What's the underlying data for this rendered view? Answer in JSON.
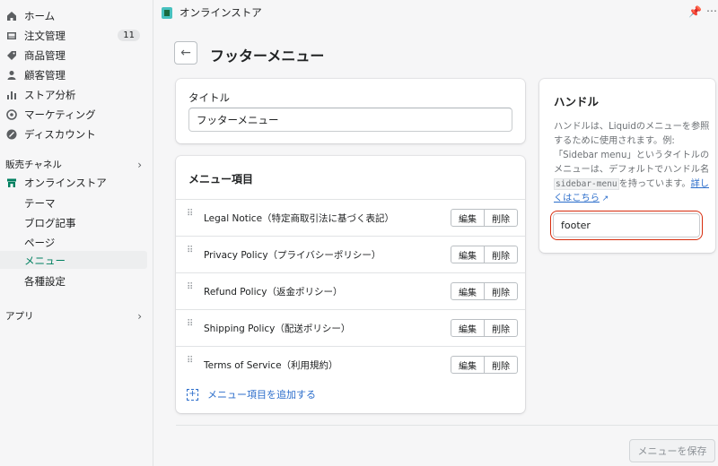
{
  "sidebar": {
    "items": [
      {
        "label": "ホーム",
        "icon": "home-icon"
      },
      {
        "label": "注文管理",
        "icon": "orders-icon",
        "badge": "11"
      },
      {
        "label": "商品管理",
        "icon": "tag-icon"
      },
      {
        "label": "顧客管理",
        "icon": "person-icon"
      },
      {
        "label": "ストア分析",
        "icon": "bar-chart-icon"
      },
      {
        "label": "マーケティング",
        "icon": "target-icon"
      },
      {
        "label": "ディスカウント",
        "icon": "discount-icon"
      }
    ],
    "sales_channel_label": "販売チャネル",
    "online_store_label": "オンラインストア",
    "sub_items": [
      "テーマ",
      "ブログ記事",
      "ページ",
      "メニュー",
      "各種設定"
    ],
    "apps_label": "アプリ"
  },
  "topbar": {
    "title": "オンラインストア"
  },
  "page": {
    "title": "フッターメニュー"
  },
  "title_card": {
    "label": "タイトル",
    "value": "フッターメニュー"
  },
  "menu_card": {
    "heading": "メニュー項目",
    "items": [
      "Legal Notice（特定商取引法に基づく表記）",
      "Privacy Policy（プライバシーポリシー）",
      "Refund Policy（返金ポリシー）",
      "Shipping Policy（配送ポリシー）",
      "Terms of Service（利用規約）"
    ],
    "edit_label": "編集",
    "delete_label": "削除",
    "add_label": "メニュー項目を追加する"
  },
  "handle_card": {
    "title": "ハンドル",
    "desc_1": "ハンドルは、Liquidのメニューを参照するために使用されます。例:「Sidebar menu」というタイトルのメニューは、デフォルトでハンドル名",
    "code": "sidebar-menu",
    "desc_2": "を持っています。",
    "learn_more": "詳しくはこちら",
    "value": "footer"
  },
  "footer": {
    "save_label": "メニューを保存"
  },
  "colors": {
    "accent": "#008060",
    "link": "#2c6ecb",
    "highlight": "#d72c0d"
  }
}
